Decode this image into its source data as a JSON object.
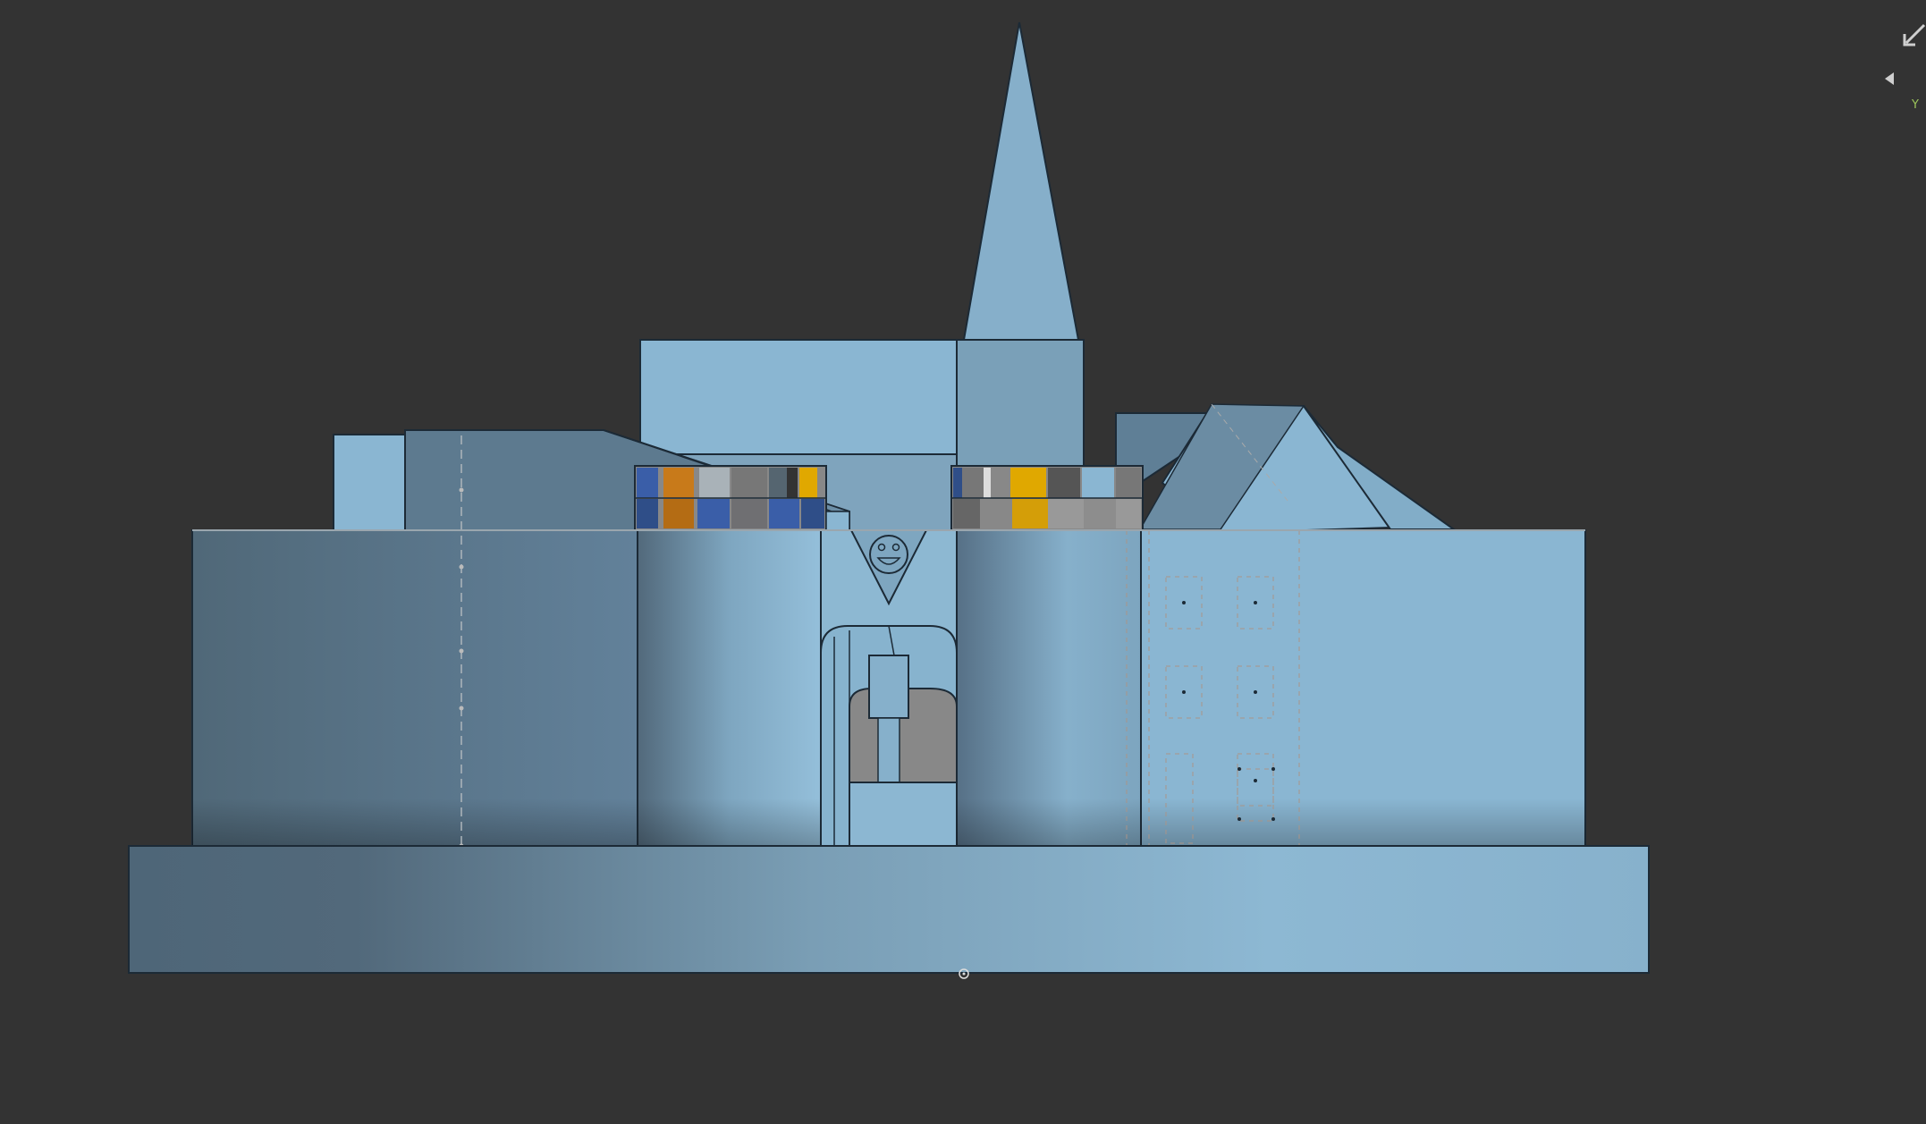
{
  "viewport": {
    "background": "#333333",
    "axis_label": "Y",
    "axis_label_color": "#9bc45a",
    "model_color": "#8ab4cf",
    "accent_colors": {
      "orange": "#c87a1a",
      "gold": "#e0a800",
      "blue": "#3a5ea8",
      "gray": "#8a8a8a"
    },
    "icons": [
      "view-gizmo-icon",
      "nav-left-arrow-icon",
      "origin-marker-icon",
      "smiley-face-icon"
    ]
  }
}
